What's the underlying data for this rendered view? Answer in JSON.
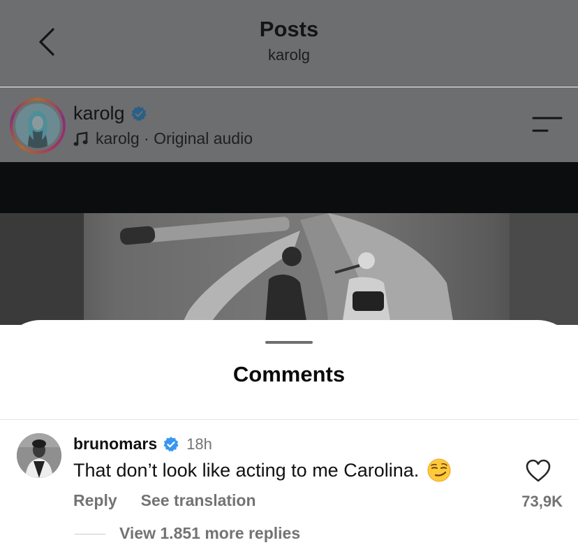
{
  "header": {
    "title": "Posts",
    "subtitle": "karolg",
    "back_icon": "chevron-left-icon"
  },
  "post": {
    "username": "karolg",
    "verified": true,
    "audio_label": "karolg · Original audio",
    "audio_icon": "music-note-icon",
    "menu_icon": "menu-icon"
  },
  "comments_sheet": {
    "title": "Comments",
    "comment": {
      "username": "brunomars",
      "verified": true,
      "time": "18h",
      "text": "That don’t look like acting to me Carolina.",
      "emoji": "smirking-face",
      "reply_label": "Reply",
      "translate_label": "See translation",
      "like_count": "73,9K",
      "view_replies_label": "View 1.851 more replies"
    }
  },
  "colors": {
    "verified_blue": "#3897f0",
    "secondary_text": "#737373",
    "overlay_gray": "#6d6e70"
  }
}
